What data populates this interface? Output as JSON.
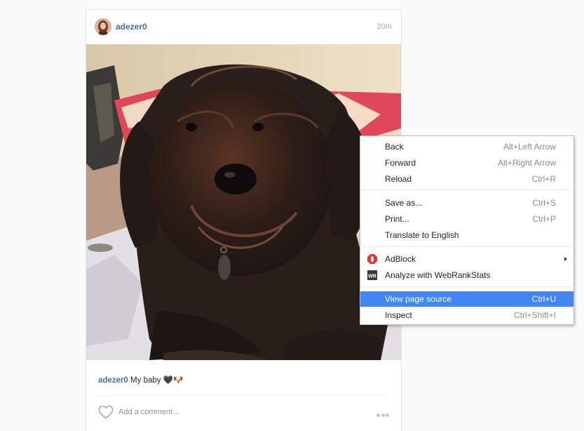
{
  "post": {
    "username": "adezer0",
    "timestamp": "20m",
    "caption": {
      "username": "adezer0",
      "text": "My baby",
      "emoji": "🖤🐶"
    },
    "comment_placeholder": "Add a comment…",
    "icons": [
      "avatar",
      "dog-photo",
      "heart-icon",
      "more-options-icon"
    ]
  },
  "context_menu": {
    "groups": [
      [
        {
          "label": "Back",
          "shortcut": "Alt+Left Arrow"
        },
        {
          "label": "Forward",
          "shortcut": "Alt+Right Arrow"
        },
        {
          "label": "Reload",
          "shortcut": "Ctrl+R"
        }
      ],
      [
        {
          "label": "Save as...",
          "shortcut": "Ctrl+S"
        },
        {
          "label": "Print...",
          "shortcut": "Ctrl+P"
        },
        {
          "label": "Translate to English",
          "shortcut": ""
        }
      ],
      [
        {
          "label": "AdBlock",
          "shortcut": "",
          "icon": "adblock-icon",
          "submenu": true
        },
        {
          "label": "Analyze with WebRankStats",
          "shortcut": "",
          "icon": "webrankstats-icon",
          "icon_text": "WR"
        }
      ],
      [
        {
          "label": "View page source",
          "shortcut": "Ctrl+U",
          "highlighted": true
        },
        {
          "label": "Inspect",
          "shortcut": "Ctrl+Shift+I"
        }
      ]
    ],
    "highlight_color": "#4285f4"
  },
  "colors": {
    "username": "#3f729b",
    "page_background": "#fafafa",
    "menu_highlight": "#4285f4"
  }
}
